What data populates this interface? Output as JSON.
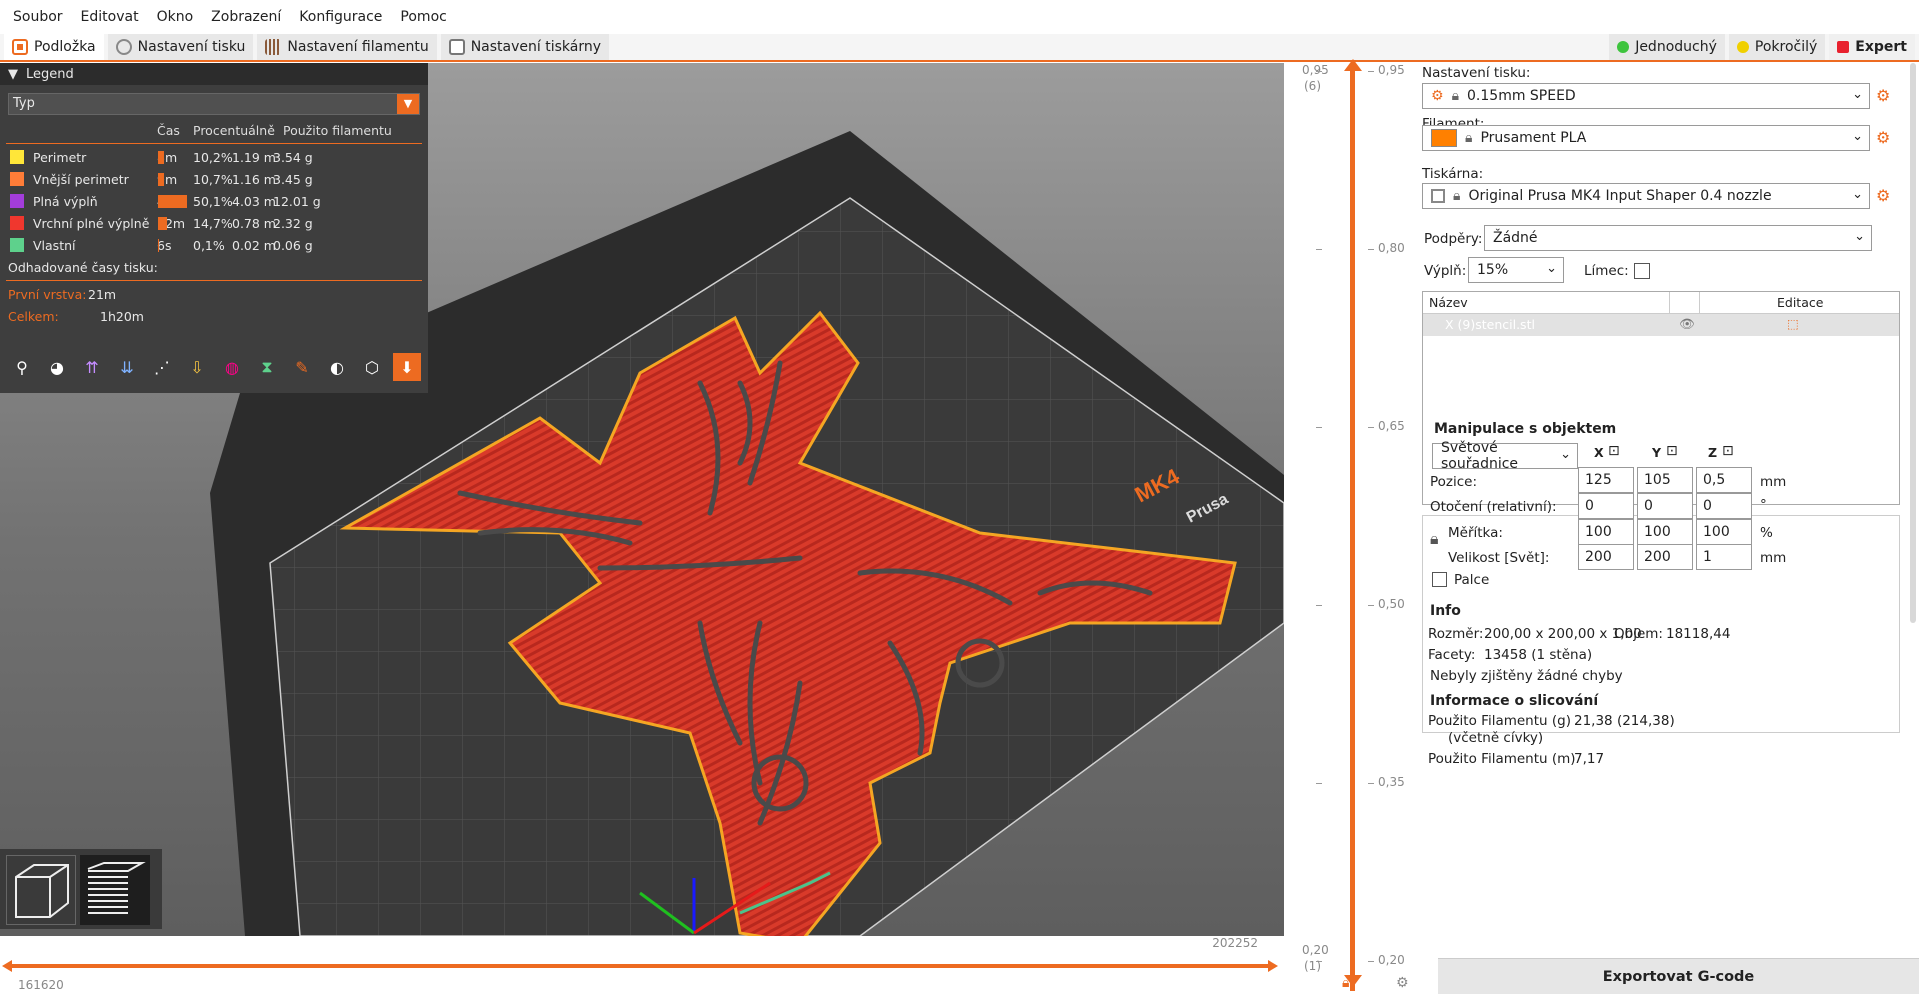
{
  "menu": [
    "Soubor",
    "Editovat",
    "Okno",
    "Zobrazení",
    "Konfigurace",
    "Pomoc"
  ],
  "tabs": [
    {
      "label": "Podložka",
      "active": true
    },
    {
      "label": "Nastavení tisku"
    },
    {
      "label": "Nastavení filamentu"
    },
    {
      "label": "Nastavení tiskárny"
    }
  ],
  "modes": [
    {
      "label": "Jednoduchý",
      "color": "#3ec43e"
    },
    {
      "label": "Pokročilý",
      "color": "#f0d000"
    },
    {
      "label": "Expert",
      "color": "#e8212e"
    }
  ],
  "legend": {
    "title": "Legend",
    "view_type": "Typ",
    "headers": {
      "time": "Čas",
      "percent": "Procentuálně",
      "filament": "Použito filamentu"
    },
    "rows": [
      {
        "name": "Perimetr",
        "color": "#ffe639",
        "time": "8m",
        "percent": "10,2%",
        "pct": 0.102,
        "len": "1.19 m",
        "weight": "3.54 g"
      },
      {
        "name": "Vnější perimetr",
        "color": "#ff7d38",
        "time": "9m",
        "percent": "10,7%",
        "pct": 0.107,
        "len": "1.16 m",
        "weight": "3.45 g"
      },
      {
        "name": "Plná výplň",
        "color": "#a33ddb",
        "time": "40m",
        "percent": "50,1%",
        "pct": 0.501,
        "len": "4.03 m",
        "weight": "12.01 g"
      },
      {
        "name": "Vrchní plné výplně",
        "color": "#f0372e",
        "time": "12m",
        "percent": "14,7%",
        "pct": 0.147,
        "len": "0.78 m",
        "weight": "2.32 g"
      },
      {
        "name": "Vlastní",
        "color": "#5ed18c",
        "time": "6s",
        "percent": "0,1%",
        "pct": 0.001,
        "len": "0.02 m",
        "weight": "0.06 g"
      }
    ],
    "estimated_label": "Odhadované časy tisku:",
    "first_layer_label": "První vrstva:",
    "first_layer_value": "21m",
    "total_label": "Celkem:",
    "total_value": "1h20m"
  },
  "vslider": {
    "top_value": "0,95",
    "top_layer": "(6)",
    "bottom_value": "0,20",
    "bottom_layer": "(1)",
    "ticks": [
      "0,95",
      "0,80",
      "0,65",
      "0,50",
      "0,35",
      "0,20"
    ]
  },
  "hslider": {
    "left": "161620",
    "right": "202252"
  },
  "sidebar": {
    "print_settings_label": "Nastavení tisku:",
    "print_settings_value": "0.15mm SPEED",
    "filament_label": "Filament:",
    "filament_value": "Prusament PLA",
    "filament_color": "#ff8000",
    "printer_label": "Tiskárna:",
    "printer_value": "Original Prusa MK4 Input Shaper 0.4 nozzle",
    "supports_label": "Podpěry:",
    "supports_value": "Žádné",
    "infill_label": "Výplň:",
    "infill_value": "15%",
    "brim_label": "Límec:",
    "list_headers": {
      "name": "Název",
      "edit": "Editace"
    },
    "objects": [
      {
        "name": "X (9)stencil.stl"
      }
    ],
    "manip_title": "Manipulace s objektem",
    "coords_value": "Světové souřadnice",
    "axes": [
      "X",
      "Y",
      "Z"
    ],
    "position_label": "Pozice:",
    "position": [
      "125",
      "105",
      "0,5"
    ],
    "position_unit": "mm",
    "rotation_label": "Otočení (relativní):",
    "rotation": [
      "0",
      "0",
      "0"
    ],
    "rotation_unit": "°",
    "scale_label": "Měřítka:",
    "scale": [
      "100",
      "100",
      "100"
    ],
    "scale_unit": "%",
    "size_label": "Velikost [Svět]:",
    "size": [
      "200",
      "200",
      "1"
    ],
    "size_unit": "mm",
    "inches_label": "Palce",
    "info_title": "Info",
    "size_info_label": "Rozměr:",
    "size_info_value": "200,00 x 200,00 x 1,00",
    "volume_label": "Objem:",
    "volume_value": "18118,44",
    "facets_label": "Facety:",
    "facets_value": "13458 (1 stěna)",
    "errors_text": "Nebyly zjištěny žádné chyby",
    "slice_title": "Informace o slicování",
    "fil_g_label": "Použito Filamentu (g)",
    "fil_g_sub": "(včetně cívky)",
    "fil_g_value": "21,38 (214,38)",
    "fil_m_label": "Použito Filamentu (m)",
    "fil_m_value": "7,17",
    "export_label": "Exportovat G-code"
  },
  "bed_label": "MK4",
  "bed_brand": "Prusa"
}
